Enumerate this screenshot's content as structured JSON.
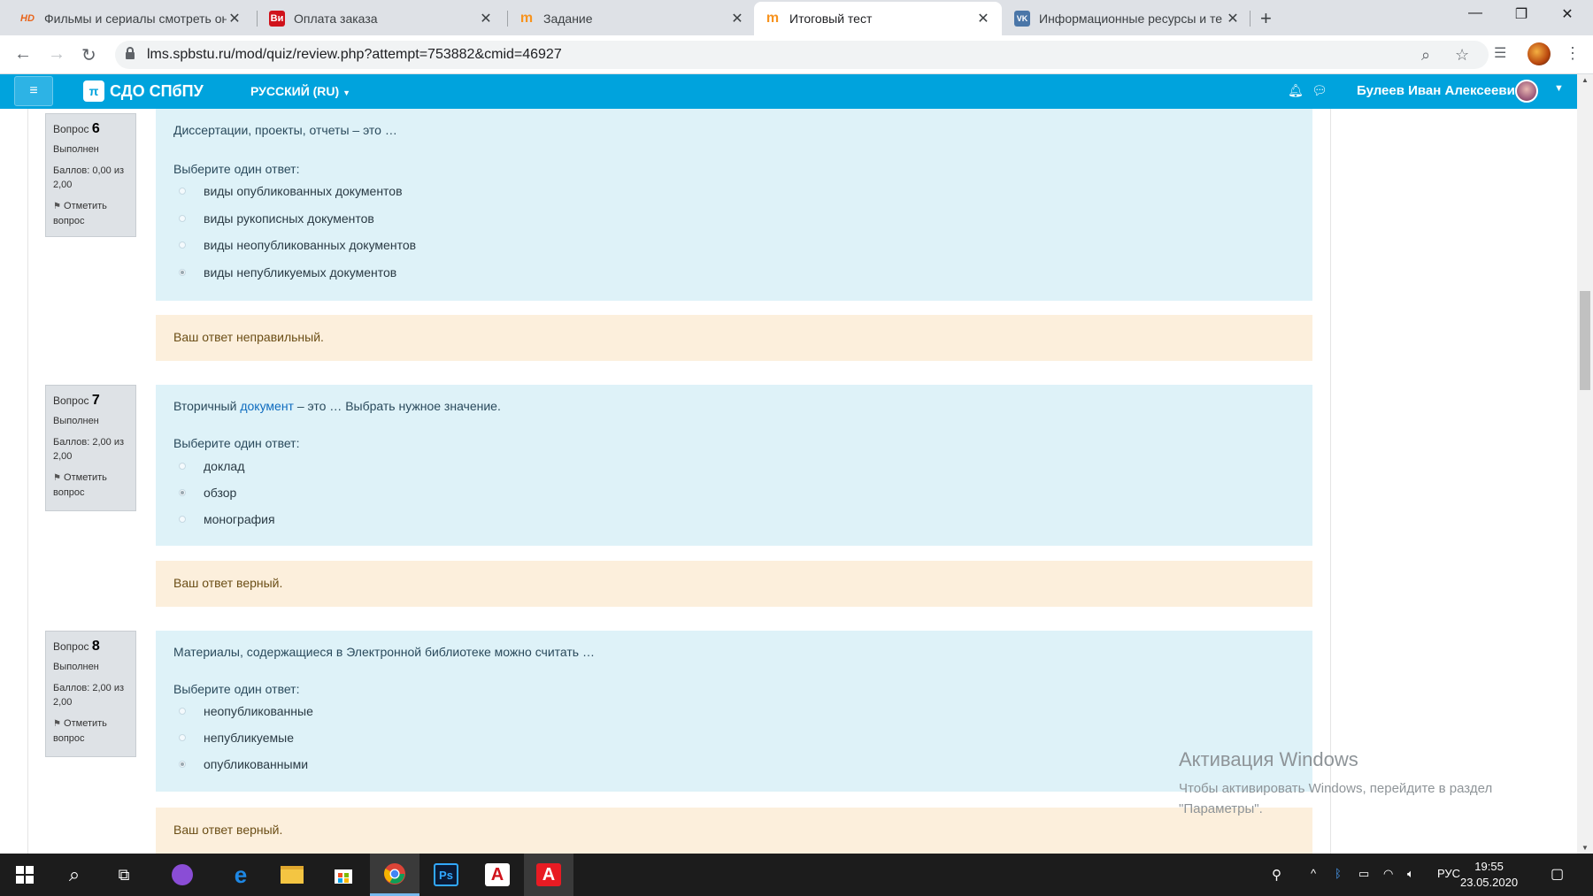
{
  "browser": {
    "tabs": [
      {
        "label": "Фильмы и сериалы смотреть он",
        "active": false,
        "favicon": "hd-favicon",
        "favicon_color": "#e8641b",
        "favicon_text": "HD"
      },
      {
        "label": "Оплата заказа",
        "active": false,
        "favicon": "vi-favicon",
        "favicon_color": "#d0121b",
        "favicon_text": "Ви"
      },
      {
        "label": "Задание",
        "active": false,
        "favicon": "moodle-favicon",
        "favicon_color": "#f7931e",
        "favicon_text": "m"
      },
      {
        "label": "Итоговый тест",
        "active": true,
        "favicon": "moodle-favicon",
        "favicon_color": "#f7931e",
        "favicon_text": "m"
      },
      {
        "label": "Информационные ресурсы и те",
        "active": false,
        "favicon": "vk-favicon",
        "favicon_color": "#4a76a8",
        "favicon_text": "VK"
      }
    ],
    "url": "lms.spbstu.ru/mod/quiz/review.php?attempt=753882&cmid=46927"
  },
  "navbar": {
    "brand": "СДО СПбПУ",
    "language": "РУССКИЙ (RU)",
    "user_name": "Булеев Иван Алексеевич"
  },
  "questions": [
    {
      "label": "Вопрос",
      "number": "6",
      "state": "Выполнен",
      "grade": "Баллов: 0,00 из 2,00",
      "flag": "Отметить вопрос",
      "text": "Диссертации, проекты, отчеты – это …",
      "prompt": "Выберите один ответ:",
      "answers": [
        {
          "text": "виды опубликованных документов",
          "checked": false
        },
        {
          "text": "виды рукописных документов",
          "checked": false
        },
        {
          "text": "виды неопубликованных документов",
          "checked": false
        },
        {
          "text": "виды непубликуемых документов",
          "checked": true
        }
      ],
      "feedback": "Ваш ответ неправильный."
    },
    {
      "label": "Вопрос",
      "number": "7",
      "state": "Выполнен",
      "grade": "Баллов: 2,00 из 2,00",
      "flag": "Отметить вопрос",
      "text_before": "Вторичный ",
      "text_link": "документ",
      "text_after": " – это … Выбрать нужное значение.",
      "prompt": "Выберите один ответ:",
      "answers": [
        {
          "text": "доклад",
          "checked": false
        },
        {
          "text": "обзор",
          "checked": true
        },
        {
          "text": "монография",
          "checked": false
        }
      ],
      "feedback": "Ваш ответ верный."
    },
    {
      "label": "Вопрос",
      "number": "8",
      "state": "Выполнен",
      "grade": "Баллов: 2,00 из 2,00",
      "flag": "Отметить вопрос",
      "text": "Материалы, содержащиеся в Электронной библиотеке можно считать …",
      "prompt": "Выберите один ответ:",
      "answers": [
        {
          "text": "неопубликованные",
          "checked": false
        },
        {
          "text": "непубликуемые",
          "checked": false
        },
        {
          "text": "опубликованными",
          "checked": true
        }
      ],
      "feedback": "Ваш ответ верный."
    }
  ],
  "watermark": {
    "title": "Активация Windows",
    "line1": "Чтобы активировать Windows, перейдите в раздел",
    "line2": "\"Параметры\"."
  },
  "taskbar": {
    "language": "РУС",
    "time": "19:55",
    "date": "23.05.2020",
    "apps": [
      "windows-start-icon",
      "search-icon",
      "task-view-icon",
      "cortana-icon",
      "edge-icon",
      "file-explorer-icon",
      "store-icon",
      "chrome-icon",
      "photoshop-icon",
      "acrobat-icon",
      "acrobat-reader-icon"
    ]
  },
  "colors": {
    "navbar": "#00a3dd",
    "formulation": "#def2f8",
    "feedback": "#fcefdc"
  }
}
